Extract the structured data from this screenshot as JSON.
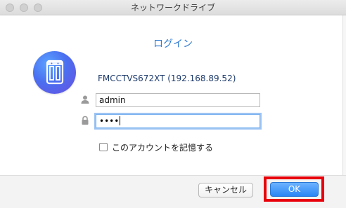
{
  "window": {
    "title": "ネットワークドライブ"
  },
  "dialog": {
    "heading": "ログイン",
    "device_name": "FMCCTVS672XT (192.168.89.52)",
    "logo_icon": "nas-device-icon"
  },
  "form": {
    "username_value": "admin",
    "password_masked": "••••",
    "remember_label": "このアカウントを記憶する",
    "remember_checked": false
  },
  "buttons": {
    "cancel_label": "キャンセル",
    "ok_label": "OK"
  },
  "colors": {
    "accent": "#2e7ad1",
    "ok_button": "#2a86f5",
    "highlight_box": "#e8000b"
  }
}
